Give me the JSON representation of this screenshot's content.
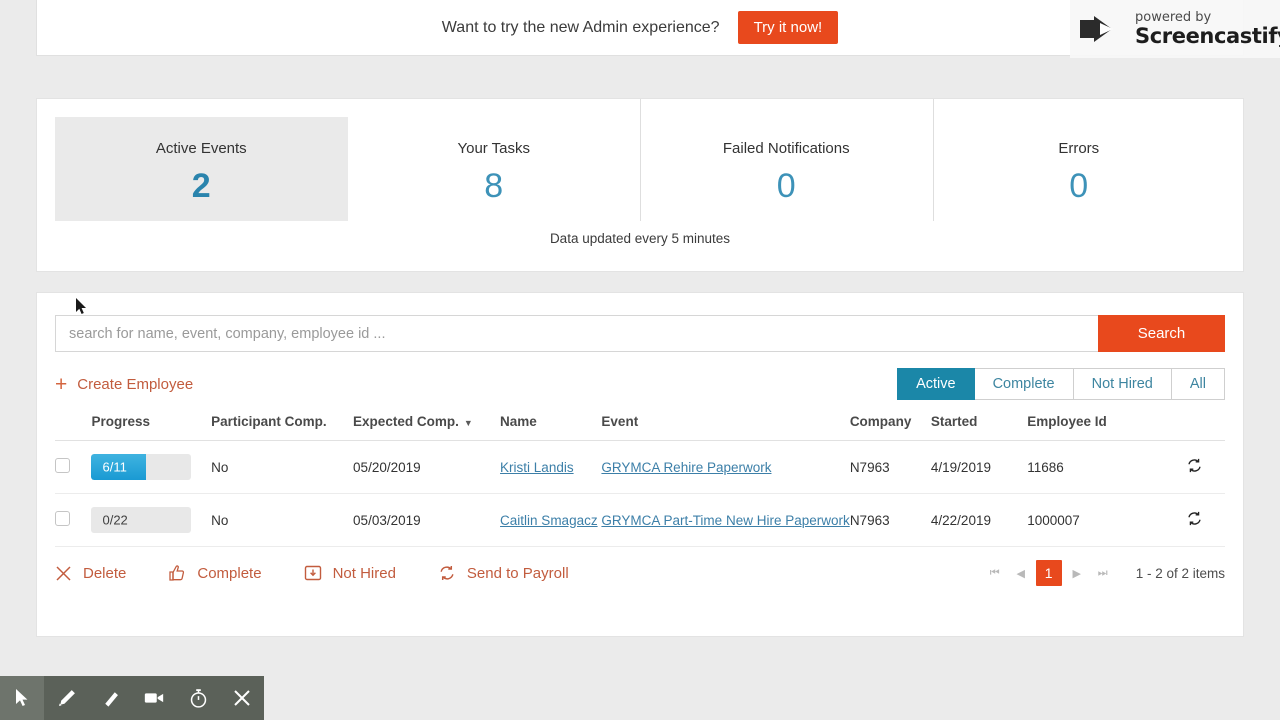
{
  "banner": {
    "message": "Want to try the new Admin experience?",
    "cta_label": "Try it now!"
  },
  "watermark": {
    "top_line": "powered by",
    "bottom_line": "Screencastify",
    "logo_icon": "screencastify-logo-icon"
  },
  "stats": {
    "footer_note": "Data updated every 5 minutes",
    "cards": [
      {
        "label": "Active Events",
        "value": "2",
        "selected": true
      },
      {
        "label": "Your Tasks",
        "value": "8",
        "selected": false
      },
      {
        "label": "Failed Notifications",
        "value": "0",
        "selected": false
      },
      {
        "label": "Errors",
        "value": "0",
        "selected": false
      }
    ]
  },
  "search": {
    "placeholder": "search for name, event, company, employee id ...",
    "value": "",
    "button_label": "Search"
  },
  "toolbar": {
    "create_label": "Create Employee",
    "create_icon": "plus-icon",
    "filters": [
      {
        "label": "Active",
        "active": true
      },
      {
        "label": "Complete",
        "active": false
      },
      {
        "label": "Not Hired",
        "active": false
      },
      {
        "label": "All",
        "active": false
      }
    ]
  },
  "table": {
    "columns": [
      "Progress",
      "Participant Comp.",
      "Expected Comp.",
      "Name",
      "Event",
      "Company",
      "Started",
      "Employee Id"
    ],
    "sorted_column": "Expected Comp.",
    "sort_direction": "desc",
    "rows": [
      {
        "checked": false,
        "progress_text": "6/11",
        "progress_done": 6,
        "progress_total": 11,
        "participant_comp": "No",
        "expected_comp": "05/20/2019",
        "name": "Kristi Landis",
        "event": "GRYMCA Rehire Paperwork",
        "company": "N7963",
        "started": "4/19/2019",
        "employee_id": "11686",
        "action_icon": "sync-icon"
      },
      {
        "checked": false,
        "progress_text": "0/22",
        "progress_done": 0,
        "progress_total": 22,
        "participant_comp": "No",
        "expected_comp": "05/03/2019",
        "name": "Caitlin Smagacz",
        "event": "GRYMCA Part-Time New Hire Paperwork",
        "company": "N7963",
        "started": "4/22/2019",
        "employee_id": "1000007",
        "action_icon": "sync-icon"
      }
    ]
  },
  "footer": {
    "actions": [
      {
        "label": "Delete",
        "icon": "x-icon"
      },
      {
        "label": "Complete",
        "icon": "thumbs-up-icon"
      },
      {
        "label": "Not Hired",
        "icon": "box-down-arrow-icon"
      },
      {
        "label": "Send to Payroll",
        "icon": "sync-icon"
      }
    ],
    "pagination": {
      "first_icon": "first-page-icon",
      "prev_icon": "prev-page-icon",
      "current_page": "1",
      "next_icon": "next-page-icon",
      "last_icon": "last-page-icon",
      "items_info": "1 - 2 of 2 items"
    }
  },
  "screencastify_toolbar": {
    "buttons": [
      {
        "icon": "cursor-icon",
        "active": true
      },
      {
        "icon": "pencil-icon",
        "active": false
      },
      {
        "icon": "eraser-icon",
        "active": false
      },
      {
        "icon": "video-camera-icon",
        "active": false
      },
      {
        "icon": "timer-icon",
        "active": false
      },
      {
        "icon": "close-icon",
        "active": false
      }
    ]
  },
  "colors": {
    "accent_orange": "#e8491d",
    "accent_teal": "#1b87a8",
    "link_blue": "#3c7fa8",
    "progress_blue": "#1a9ad3",
    "action_terracotta": "#c25c3e"
  }
}
